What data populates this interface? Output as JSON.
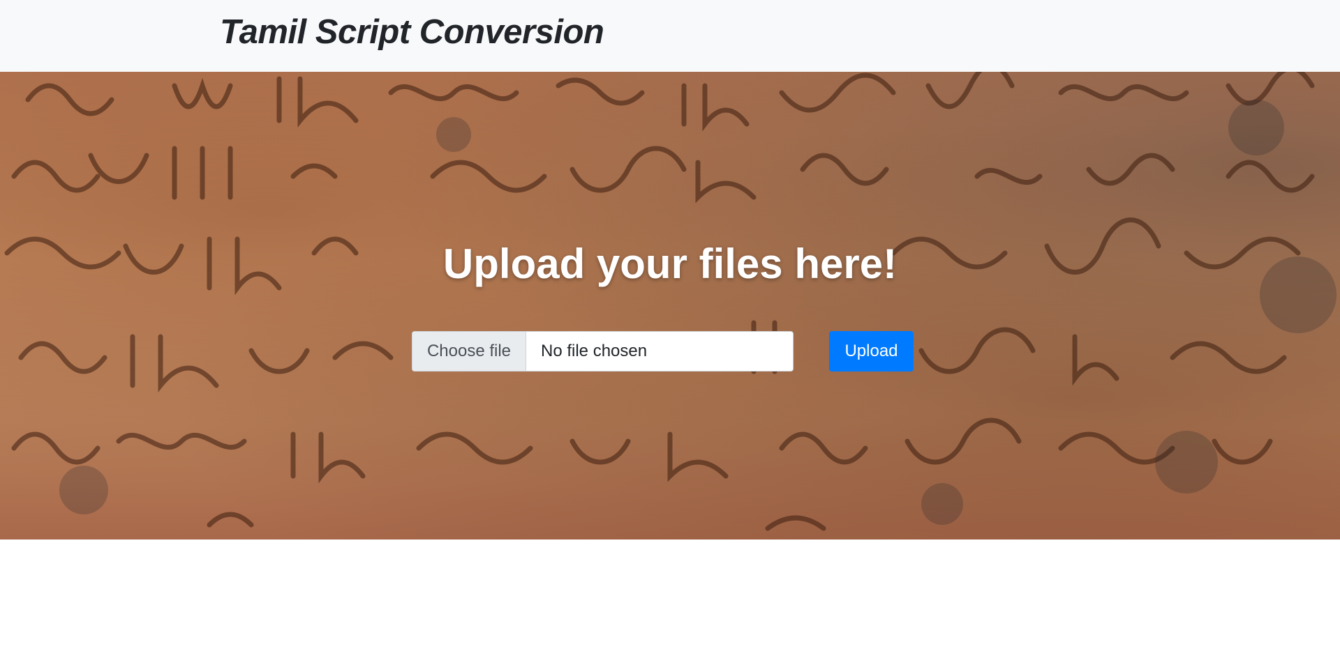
{
  "navbar": {
    "brand": "Tamil Script Conversion"
  },
  "hero": {
    "title": "Upload your files here!",
    "background_description_icon": "stone-inscription-background"
  },
  "upload_form": {
    "choose_file_label": "Choose file",
    "file_status": "No file chosen",
    "upload_label": "Upload"
  },
  "colors": {
    "navbar_bg": "#f8f9fa",
    "upload_button": "#007bff",
    "choose_button_bg": "#e9ecef"
  }
}
